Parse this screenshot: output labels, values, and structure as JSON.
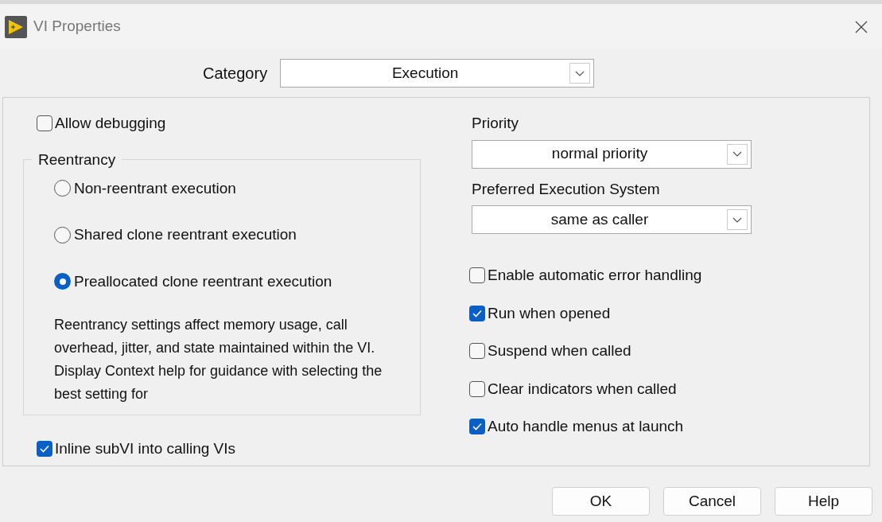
{
  "window": {
    "title": "VI Properties"
  },
  "category": {
    "label": "Category",
    "value": "Execution"
  },
  "allow_debugging": {
    "label": "Allow debugging",
    "checked": false
  },
  "reentrancy": {
    "title": "Reentrancy",
    "options": [
      {
        "label": "Non-reentrant execution",
        "selected": false
      },
      {
        "label": "Shared clone reentrant execution",
        "selected": false
      },
      {
        "label": "Preallocated clone reentrant execution",
        "selected": true
      }
    ],
    "description": "Reentrancy settings affect memory usage, call overhead, jitter, and state maintained within the VI. Display Context help for guidance with selecting the best setting for"
  },
  "inline_subvi": {
    "label": "Inline subVI into calling VIs",
    "checked": true
  },
  "priority": {
    "label": "Priority",
    "value": "normal priority"
  },
  "execution_system": {
    "label": "Preferred Execution System",
    "value": "same as caller"
  },
  "options": [
    {
      "label": "Enable automatic error handling",
      "checked": false
    },
    {
      "label": "Run when opened",
      "checked": true
    },
    {
      "label": "Suspend when called",
      "checked": false
    },
    {
      "label": "Clear indicators when called",
      "checked": false
    },
    {
      "label": "Auto handle menus at launch",
      "checked": true
    }
  ],
  "buttons": [
    "OK",
    "Cancel",
    "Help"
  ]
}
